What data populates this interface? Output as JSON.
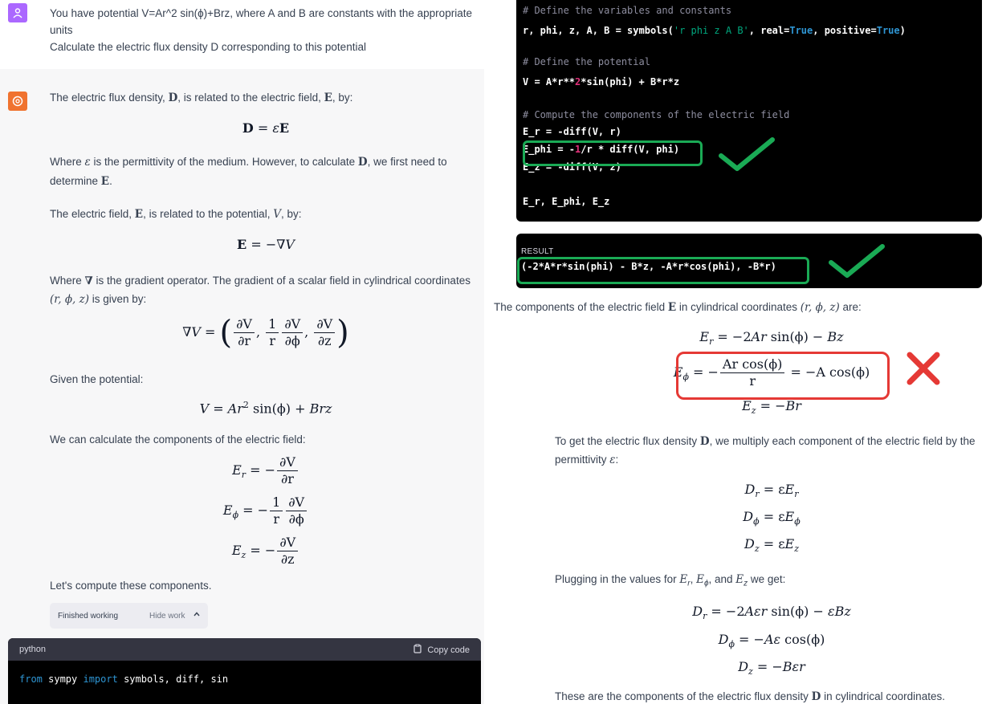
{
  "left": {
    "user": {
      "text_line1": "You have potential V=Ar^2  sin(ϕ)+Brz, where A and B are constants with the appropriate",
      "text_line2": "units",
      "text_line3": "Calculate the electric flux density D corresponding to this potential"
    },
    "assistant": {
      "p1": [
        "The electric flux density, ",
        "D",
        ", is related to the electric field, ",
        "E",
        ", by:"
      ],
      "eq1": [
        "D",
        " = ",
        "ε",
        "E"
      ],
      "p2a": [
        "Where ",
        "ε",
        " is the permittivity of the medium. However, to calculate ",
        "D",
        ", we first need to"
      ],
      "p2b": [
        "determine ",
        "E",
        "."
      ],
      "p3": [
        "The electric field, ",
        "E",
        ", is related to the potential, ",
        "V",
        ", by:"
      ],
      "eq2": [
        "E",
        " = −∇",
        "V"
      ],
      "p4a": [
        "Where ",
        "∇",
        " is the gradient operator. The gradient of a scalar field in cylindrical coordinates"
      ],
      "p4b": [
        "(r, ϕ, z)",
        " is given by:"
      ],
      "eq3": {
        "lhs": "∇V = ",
        "t1n": "∂V",
        "t1d": "∂r",
        "c": ", ",
        "t2n": "1",
        "t2d": "r",
        "t3n": "∂V",
        "t3d": "∂ϕ",
        "t4n": "∂V",
        "t4d": "∂z"
      },
      "p5": "Given the potential:",
      "eq4": [
        "V",
        " = ",
        "Ar",
        "2",
        " sin(ϕ) + ",
        "Brz"
      ],
      "p6": "We can calculate the components of the electric field:",
      "eq5": [
        {
          "lhs": "E",
          "sub": "r",
          "mid": " = −",
          "pre": "",
          "num": "∂V",
          "den": "∂r"
        },
        {
          "lhs": "E",
          "sub": "ϕ",
          "mid": " = −",
          "pre": "1",
          "pred": "r",
          "num": "∂V",
          "den": "∂ϕ"
        },
        {
          "lhs": "E",
          "sub": "z",
          "mid": " = −",
          "pre": "",
          "num": "∂V",
          "den": "∂z"
        }
      ],
      "p7": "Let's compute these components.",
      "finished": "Finished working",
      "hide_work": "Hide work",
      "code_lang": "python",
      "copy_code": "Copy code",
      "code_line": [
        "from",
        " sympy ",
        "import",
        " symbols, diff, sin"
      ]
    }
  },
  "right": {
    "code": [
      {
        "kind": "cmt",
        "text": "# Define the variables and constants"
      },
      {
        "kind": "mixed",
        "parts": [
          [
            "",
            "r, phi, z, A, B = symbols("
          ],
          [
            "str",
            "'r phi z A B'"
          ],
          [
            "",
            ", real="
          ],
          [
            "blue",
            "True"
          ],
          [
            "",
            ", positive="
          ],
          [
            "blue",
            "True"
          ],
          [
            "",
            ")"
          ]
        ]
      },
      {
        "kind": "blank",
        "text": ""
      },
      {
        "kind": "cmt",
        "text": "# Define the potential"
      },
      {
        "kind": "mixed",
        "parts": [
          [
            "",
            "V = A*r**"
          ],
          [
            "red",
            "2"
          ],
          [
            "",
            "*sin(phi) + B*r*z"
          ]
        ]
      },
      {
        "kind": "blank",
        "text": ""
      },
      {
        "kind": "cmt",
        "text": "# Compute the components of the electric field"
      },
      {
        "kind": "mixed",
        "parts": [
          [
            "",
            "E_r = -diff(V, r)"
          ]
        ]
      },
      {
        "kind": "mixed",
        "parts": [
          [
            "",
            "E_phi = -"
          ],
          [
            "red",
            "1"
          ],
          [
            "",
            "/r * diff(V, phi)"
          ]
        ]
      },
      {
        "kind": "mixed",
        "parts": [
          [
            "",
            "E_z = -diff(V, z)"
          ]
        ]
      },
      {
        "kind": "blank",
        "text": ""
      },
      {
        "kind": "mixed",
        "parts": [
          [
            "",
            "E_r, E_phi, E_z"
          ]
        ]
      }
    ],
    "result_label": "RESULT",
    "result_text": "(-2*A*r*sin(phi) - B*z, -A*r*cos(phi), -B*r)",
    "p1": [
      "The components of the electric field ",
      "E",
      " in cylindrical coordinates ",
      "(r, ϕ, z)",
      " are:"
    ],
    "er": [
      "E",
      "r",
      " = −2",
      "Ar",
      " sin(ϕ) − ",
      "Bz"
    ],
    "ephi": {
      "lhs": "E",
      "sub": "ϕ",
      "mid": " = −",
      "num": "Ar cos(ϕ)",
      "den": "r",
      "rhs": " = −A cos(ϕ)"
    },
    "ez": [
      "E",
      "z",
      " = −",
      "Br"
    ],
    "p2a": [
      "To get the electric flux density ",
      "D",
      ", we multiply each component of the electric field by the"
    ],
    "p2b": [
      "permittivity ",
      "ε",
      ":"
    ],
    "d1": [
      "D",
      "r",
      " = ε",
      "E",
      "r"
    ],
    "d2": [
      "D",
      "ϕ",
      " = ε",
      "E",
      "ϕ"
    ],
    "d3": [
      "D",
      "z",
      " = ε",
      "E",
      "z"
    ],
    "p3": [
      "Plugging in the values for ",
      "E",
      "r",
      ", ",
      "E",
      "ϕ",
      ", and ",
      "E",
      "z",
      " we get:"
    ],
    "f1": [
      "D",
      "r",
      " = −2",
      "Aεr",
      " sin(ϕ) − ",
      "εBz"
    ],
    "f2": [
      "D",
      "ϕ",
      " = −",
      "Aε",
      " cos(ϕ)"
    ],
    "f3": [
      "D",
      "z",
      " = −",
      "Bεr"
    ],
    "p4": [
      "These are the components of the electric flux density ",
      "D",
      " in cylindrical coordinates."
    ]
  },
  "colors": {
    "check": "#1aaa55",
    "cross": "#e53935",
    "code_bg": "#000000",
    "assistant_bg": "#f7f7f8"
  },
  "icons": [
    "user-icon",
    "openai-logo-icon",
    "chevron-up-icon",
    "clipboard-icon",
    "check-icon",
    "cross-icon"
  ]
}
